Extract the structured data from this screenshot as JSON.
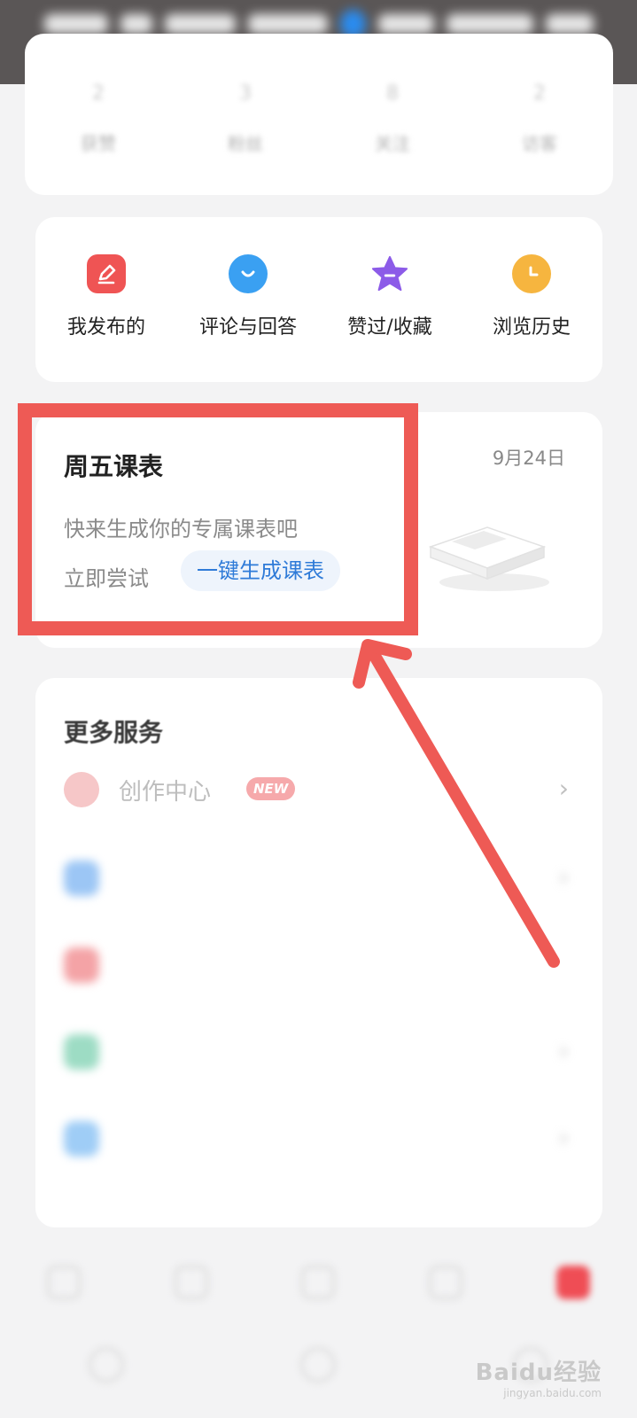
{
  "stats": [
    {
      "value": "2",
      "label": "获赞"
    },
    {
      "value": "3",
      "label": "粉丝"
    },
    {
      "value": "8",
      "label": "关注"
    },
    {
      "value": "2",
      "label": "访客"
    }
  ],
  "quick_actions": [
    {
      "label": "我发布的",
      "icon": "pencil-icon",
      "color": "#ef5454"
    },
    {
      "label": "评论与回答",
      "icon": "chat-icon",
      "color": "#3aa0f2"
    },
    {
      "label": "赞过/收藏",
      "icon": "star-icon",
      "color": "#8c5be8"
    },
    {
      "label": "浏览历史",
      "icon": "clock-icon",
      "color": "#f6b53f"
    }
  ],
  "schedule": {
    "title": "周五课表",
    "date": "9月24日",
    "description": "快来生成你的专属课表吧",
    "try_label": "立即尝试",
    "generate_button": "一键生成课表"
  },
  "services": {
    "title": "更多服务",
    "items": [
      {
        "label": "创作中心",
        "badge": "NEW",
        "icon": "lightbulb-icon",
        "color": "#f6a8aa"
      },
      {
        "label": "",
        "icon": "shirt-icon",
        "color": "#9cc6f5"
      },
      {
        "label": "",
        "icon": "gift-icon",
        "color": "#f4a3a6"
      },
      {
        "label": "",
        "icon": "person-icon",
        "color": "#9ddcc4"
      },
      {
        "label": "",
        "icon": "calendar-icon",
        "color": "#9fcdf6"
      }
    ]
  },
  "bottom_nav": [
    {
      "label": "",
      "icon": "home-icon"
    },
    {
      "label": "",
      "icon": "compass-icon"
    },
    {
      "label": "",
      "icon": "message-icon"
    },
    {
      "label": "",
      "icon": "bell-icon"
    },
    {
      "label": "",
      "icon": "user-icon",
      "active": true
    }
  ],
  "watermark": {
    "main": "Baidu经验",
    "sub": "jingyan.baidu.com"
  },
  "annotation": {
    "color": "#ee5a55"
  }
}
